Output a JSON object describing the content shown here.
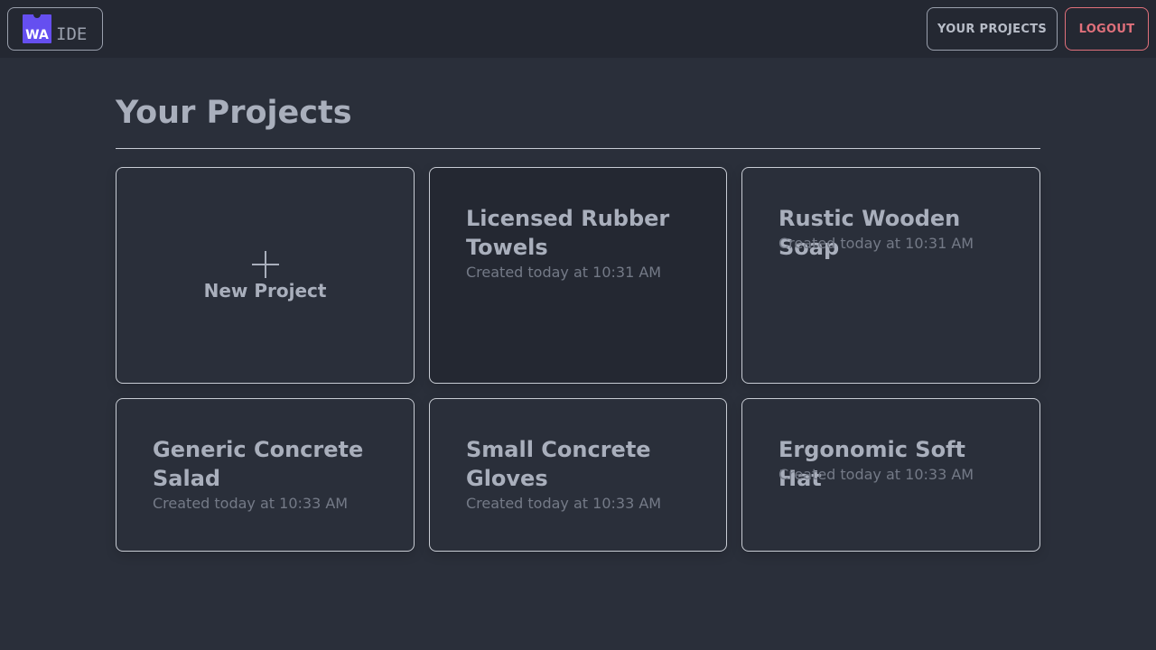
{
  "header": {
    "logo_badge": "WA",
    "logo_text": "IDE",
    "your_projects_label": "YOUR PROJECTS",
    "logout_label": "LOGOUT"
  },
  "main": {
    "title": "Your Projects",
    "new_project_label": "New Project",
    "projects": [
      {
        "name": "Licensed Rubber Towels",
        "created": "Created today at 10:31 AM"
      },
      {
        "name": "Rustic Wooden Soap",
        "created": "Created today at 10:31 AM"
      },
      {
        "name": "Generic Concrete Salad",
        "created": "Created today at 10:33 AM"
      },
      {
        "name": "Small Concrete Gloves",
        "created": "Created today at 10:33 AM"
      },
      {
        "name": "Ergonomic Soft Hat",
        "created": "Created today at 10:33 AM"
      }
    ]
  },
  "colors": {
    "brand": "#654ff0",
    "background": "#2a2f3a",
    "topbar": "#242832",
    "logout": "#e0707b"
  },
  "icons": {
    "new_project": "plus-icon"
  }
}
